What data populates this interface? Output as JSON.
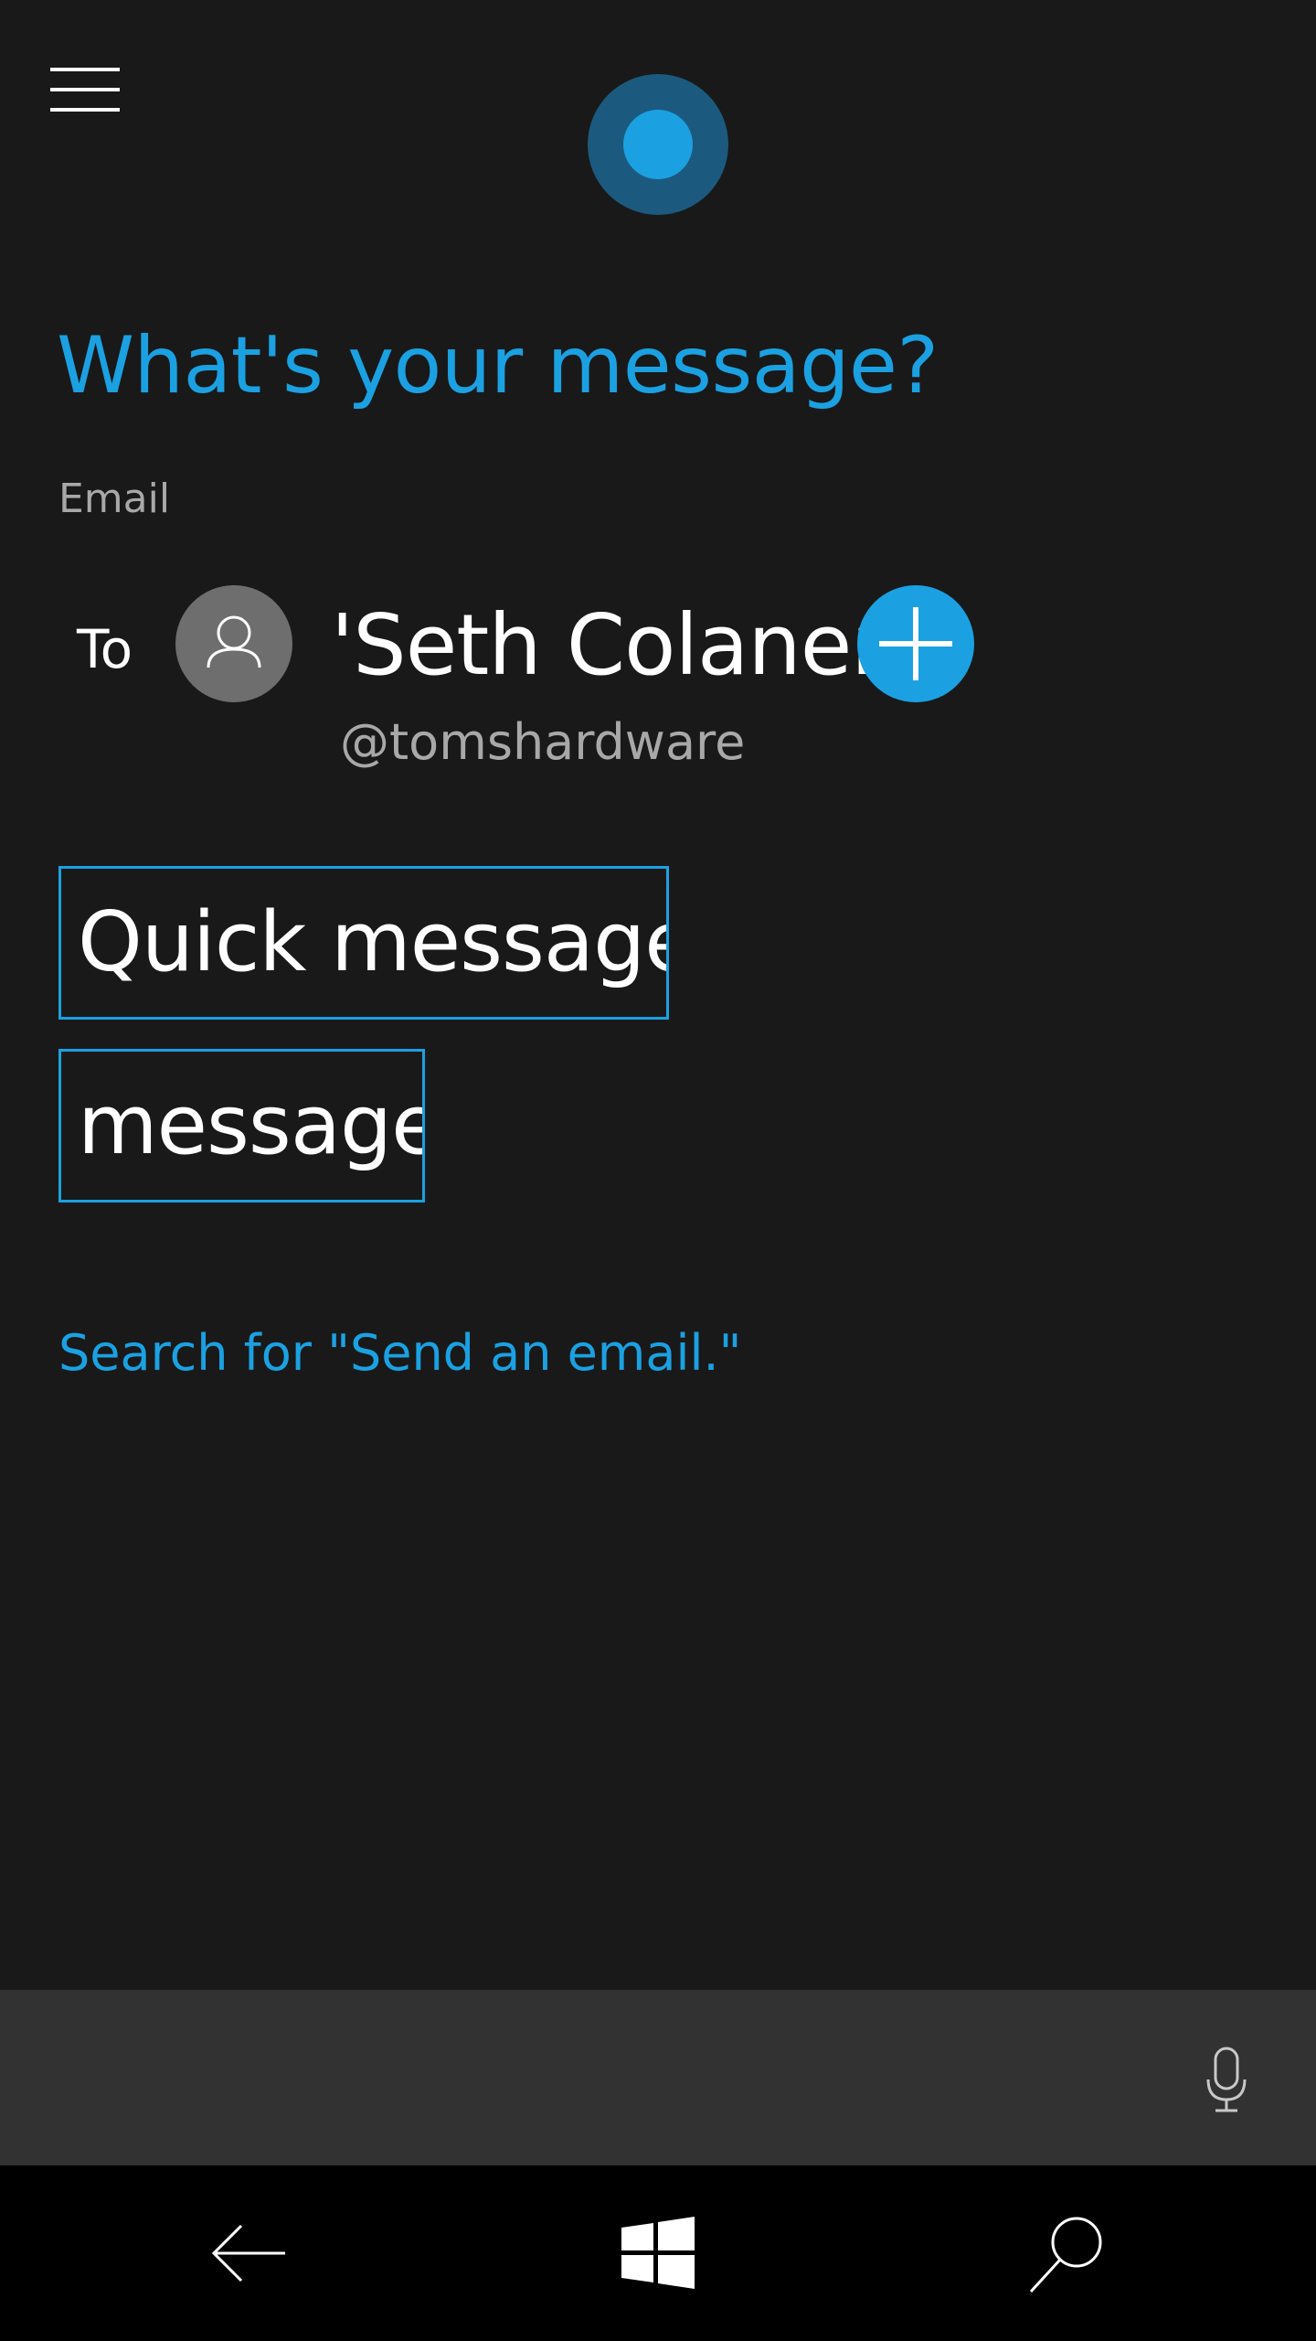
{
  "header": {
    "menu_icon": "hamburger-icon",
    "assistant_icon": "cortana-circle-icon"
  },
  "prompt": {
    "question": "What's your message?",
    "app_label": "Email"
  },
  "recipient": {
    "to_label": "To",
    "avatar_icon": "person-icon",
    "name": "'Seth Colaner'",
    "handle": "@tomshardware",
    "add_icon": "plus-icon"
  },
  "fields": {
    "subject": "Quick message",
    "body": "message"
  },
  "search_link": "Search for \"Send an email.\"",
  "input_bar": {
    "mic_icon": "microphone-icon"
  },
  "navbar": {
    "back_icon": "back-arrow-icon",
    "start_icon": "windows-logo-icon",
    "search_icon": "search-icon"
  },
  "colors": {
    "background": "#191919",
    "accent": "#1ba1e2",
    "accent_dark": "#1b5a7e",
    "secondary_text": "#a8a8a8",
    "input_bar": "#323232",
    "navbar": "#000000"
  }
}
